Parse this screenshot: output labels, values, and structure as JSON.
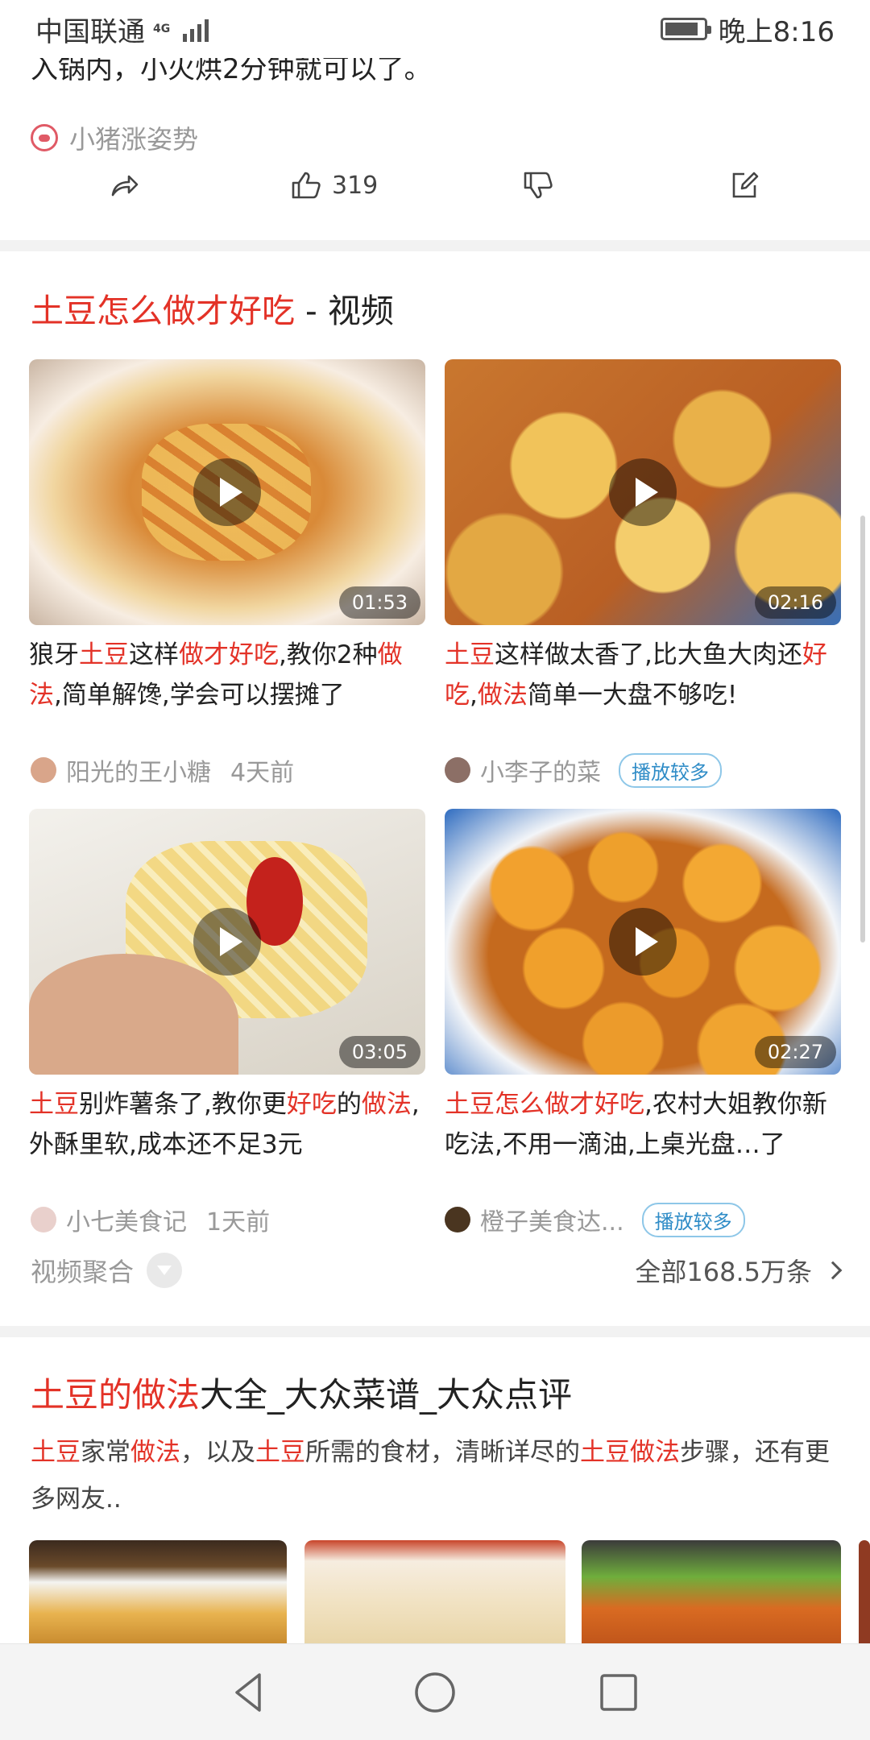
{
  "status_bar": {
    "carrier": "中国联通",
    "network": "4G",
    "time": "晚上8:16"
  },
  "previous_card": {
    "text_tail": "入锅内，小火烘2分钟就可以了。",
    "author": "小猪涨姿势",
    "likes": "319"
  },
  "video_section": {
    "title_highlight": "土豆怎么做才好吃",
    "title_suffix": " - 视频",
    "videos": [
      {
        "duration": "01:53",
        "title": [
          {
            "t": "狼牙",
            "h": false
          },
          {
            "t": "土豆",
            "h": true
          },
          {
            "t": "这样",
            "h": false
          },
          {
            "t": "做才好吃",
            "h": true
          },
          {
            "t": ",教你2种",
            "h": false
          },
          {
            "t": "做法",
            "h": true
          },
          {
            "t": ",简单解馋,学会可以摆摊了",
            "h": false
          }
        ],
        "author": "阳光的王小糖",
        "time": "4天前",
        "badge": ""
      },
      {
        "duration": "02:16",
        "title": [
          {
            "t": "土豆",
            "h": true
          },
          {
            "t": "这样做太香了,比大鱼大肉还",
            "h": false
          },
          {
            "t": "好吃",
            "h": true
          },
          {
            "t": ",",
            "h": false
          },
          {
            "t": "做法",
            "h": true
          },
          {
            "t": "简单一大盘不够吃!",
            "h": false
          }
        ],
        "author": "小李子的菜",
        "time": "",
        "badge": "播放较多"
      },
      {
        "duration": "03:05",
        "title": [
          {
            "t": "土豆",
            "h": true
          },
          {
            "t": "别炸薯条了,教你更",
            "h": false
          },
          {
            "t": "好吃",
            "h": true
          },
          {
            "t": "的",
            "h": false
          },
          {
            "t": "做法",
            "h": true
          },
          {
            "t": ",外酥里软,成本还不足3元",
            "h": false
          }
        ],
        "author": "小七美食记",
        "time": "1天前",
        "badge": ""
      },
      {
        "duration": "02:27",
        "title": [
          {
            "t": "土豆怎么做才好吃",
            "h": true
          },
          {
            "t": ",农村大姐教你新吃法,不用一滴油,上桌光盘…了",
            "h": false
          }
        ],
        "author": "橙子美食达...",
        "time": "",
        "badge": "播放较多"
      }
    ],
    "aggregate_label": "视频聚合",
    "all_count": "全部168.5万条"
  },
  "recipe_section": {
    "title_highlight": "土豆的做法",
    "title_suffix": "大全_大众菜谱_大众点评",
    "desc": [
      {
        "t": "土豆",
        "h": true
      },
      {
        "t": "家常",
        "h": false
      },
      {
        "t": "做法",
        "h": true
      },
      {
        "t": "，以及",
        "h": false
      },
      {
        "t": "土豆",
        "h": true
      },
      {
        "t": "所需的食材，清晰详尽的",
        "h": false
      },
      {
        "t": "土豆做法",
        "h": true
      },
      {
        "t": "步骤，还有更多网友..",
        "h": false
      }
    ]
  },
  "colors": {
    "highlight": "#e33227",
    "badge": "#2f8cc7"
  }
}
